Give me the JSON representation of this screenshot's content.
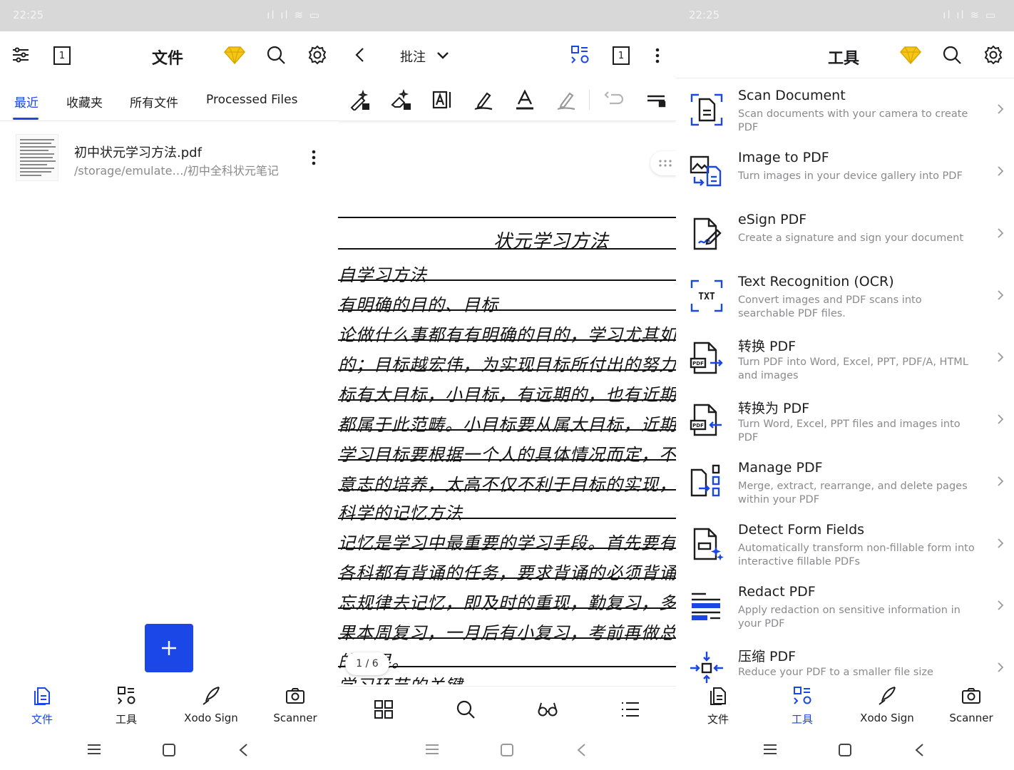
{
  "status": {
    "time1": "22:25",
    "time3": "22:25",
    "signal": "ıl ıl ≋ ▭"
  },
  "files_screen": {
    "title": "文件",
    "page_count": "1",
    "tabs": [
      "最近",
      "收藏夹",
      "所有文件",
      "Processed Files"
    ],
    "active_tab": 0,
    "recent": [
      {
        "name": "初中状元学习方法.pdf",
        "path": "/storage/emulate…/初中全科状元笔记"
      }
    ]
  },
  "bottom_nav": [
    "文件",
    "工具",
    "Xodo Sign",
    "Scanner"
  ],
  "viewer": {
    "mode_label": "批注",
    "page_count": "1",
    "page_indicator": "1 / 6",
    "doc_title": "状元学习方法",
    "doc_lines": [
      "自学习方法",
      "有明确的目的、目标",
      "论做什么事都有有明确的目的，学习尤其如此。",
      "的；目标越宏伟，为实现目标所付出的努力越",
      "标有大目标，小目标，有远期的，也有近期的，",
      "都属于此范畴。小目标要从属大目标，近期目标",
      "学习目标要根据一个人的具体情况而定，不能",
      "意志的培养，太高不仅不利于目标的实现，学",
      "科学的记忆方法",
      "记忆是学习中最重要的学习手段。首先要有时间",
      "各科都有背诵的任务，要求背诵的必须背诵",
      "忘规律去记忆，即及时的重现，勤复习，多复习",
      "果本周复习，一月后有小复习，考前再做总复习，效",
      "的效果。",
      "学习环节的关键"
    ]
  },
  "tools_screen": {
    "title": "工具",
    "tools": [
      {
        "icon": "scan-document-icon",
        "title": "Scan Document",
        "desc": "Scan documents with your camera to create PDF"
      },
      {
        "icon": "image-to-pdf-icon",
        "title": "Image to PDF",
        "desc": "Turn images in your device gallery into PDF"
      },
      {
        "icon": "esign-icon",
        "title": "eSign PDF",
        "desc": "Create a signature and sign your document"
      },
      {
        "icon": "ocr-icon",
        "title": "Text Recognition (OCR)",
        "desc": "Convert images and PDF scans into searchable PDF files."
      },
      {
        "icon": "convert-pdf-icon",
        "title": "转换 PDF",
        "desc": "Turn PDF into Word, Excel, PPT, PDF/A, HTML and images"
      },
      {
        "icon": "convert-to-pdf-icon",
        "title": "转换为 PDF",
        "desc": "Turn Word, Excel, PPT files and images into PDF"
      },
      {
        "icon": "manage-pdf-icon",
        "title": "Manage PDF",
        "desc": "Merge, extract, rearrange, and delete pages within your PDF"
      },
      {
        "icon": "detect-form-icon",
        "title": "Detect Form Fields",
        "desc": "Automatically transform non-fillable form into interactive fillable PDFs"
      },
      {
        "icon": "redact-pdf-icon",
        "title": "Redact PDF",
        "desc": "Apply redaction on sensitive information in your PDF"
      },
      {
        "icon": "compress-pdf-icon",
        "title": "压缩 PDF",
        "desc": "Reduce your PDF to a smaller file size"
      }
    ]
  },
  "colors": {
    "accent": "#1a47e5",
    "premium": "#f5c518",
    "text": "#1d1d1f",
    "secondary": "#8a8a8e"
  }
}
